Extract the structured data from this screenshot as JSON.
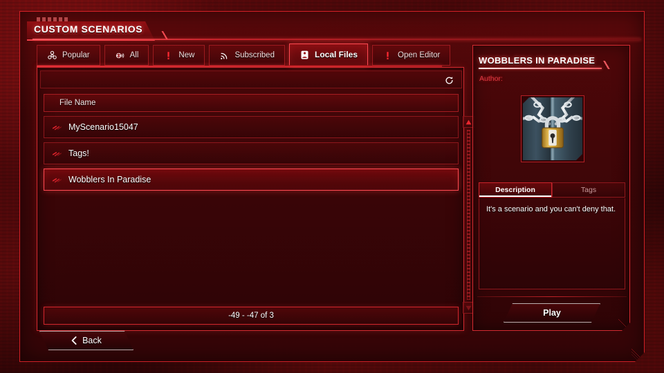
{
  "window": {
    "title": "CUSTOM SCENARIOS"
  },
  "tabs": [
    {
      "id": "popular",
      "label": "Popular",
      "icon": "biohazard-icon",
      "active": false
    },
    {
      "id": "all",
      "label": "All",
      "icon": "globe-signal-icon",
      "active": false
    },
    {
      "id": "new",
      "label": "New",
      "icon": "exclamation-icon",
      "active": false
    },
    {
      "id": "subscribed",
      "label": "Subscribed",
      "icon": "rss-icon",
      "active": false
    },
    {
      "id": "local-files",
      "label": "Local Files",
      "icon": "local-file-icon",
      "active": true
    },
    {
      "id": "open-editor",
      "label": "Open Editor",
      "icon": "exclamation-icon",
      "active": false
    }
  ],
  "list": {
    "refresh_icon": "refresh-icon",
    "column_header": "File Name",
    "row_icon": "claw-icon",
    "rows": [
      {
        "name": "MyScenario15047",
        "selected": false
      },
      {
        "name": "Tags!",
        "selected": false
      },
      {
        "name": "Wobblers In Paradise",
        "selected": true
      }
    ],
    "pager_text": "-49 - -47 of 3",
    "scrollbar": {
      "up_icon": "triangle-up-icon",
      "down_icon": "triangle-down-icon"
    }
  },
  "detail": {
    "title": "WOBBLERS IN PARADISE",
    "author_label": "Author:",
    "author_value": "",
    "thumbnail_icon": "padlock-chains-icon",
    "info_tabs": [
      {
        "id": "description",
        "label": "Description",
        "active": true
      },
      {
        "id": "tags",
        "label": "Tags",
        "active": false
      }
    ],
    "description": "It's a scenario and you can't deny that.",
    "play_label": "Play"
  },
  "footer": {
    "back_label": "Back",
    "back_chevron": "chevron-left-icon"
  },
  "colors": {
    "accent": "#d42a30",
    "accent_bright": "#ff4a52",
    "panel_bg": "#46060880",
    "text": "#ffffff",
    "text_dim": "#c79a9c"
  }
}
